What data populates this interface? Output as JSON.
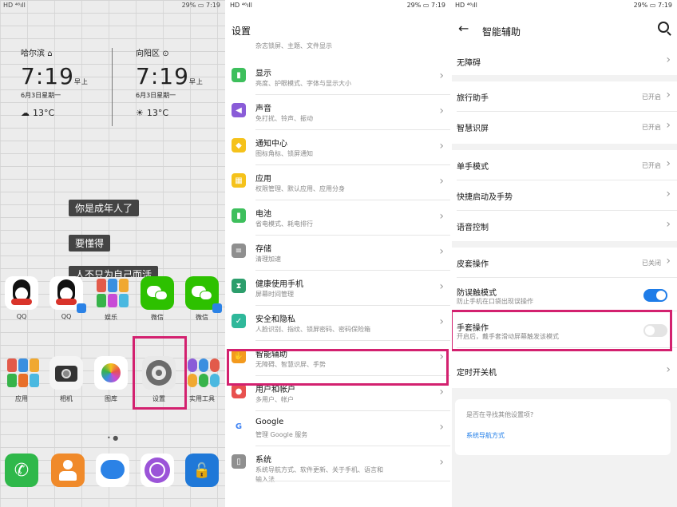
{
  "status": {
    "left": "HD ⁴⁶ıll",
    "battery": "29%",
    "time": "7:19"
  },
  "home": {
    "clock1": {
      "city": "哈尔滨",
      "time": "7:19",
      "ampm": "早上",
      "date": "6月3日星期一",
      "temp": "13°C"
    },
    "clock2": {
      "city": "向阳区",
      "time": "7:19",
      "ampm": "早上",
      "date": "6月3日星期一",
      "temp": "13°C"
    },
    "banners": [
      "你是成年人了",
      "要懂得",
      "人不只为自己而活"
    ],
    "row1": [
      {
        "label": "QQ"
      },
      {
        "label": "QQ"
      },
      {
        "label": "娱乐"
      },
      {
        "label": "微信"
      },
      {
        "label": "微信"
      }
    ],
    "row2": [
      {
        "label": "应用"
      },
      {
        "label": "相机"
      },
      {
        "label": "图库"
      },
      {
        "label": "设置"
      },
      {
        "label": "实用工具"
      }
    ]
  },
  "settings": {
    "title": "设置",
    "top_partial": "杂志锁屏、主题、文件显示",
    "items": [
      {
        "title": "显示",
        "sub": "亮度、护眼模式、字体与显示大小",
        "color": "#3dbf5c",
        "icon": "▮"
      },
      {
        "title": "声音",
        "sub": "免打扰、铃声、振动",
        "color": "#8a5cd8",
        "icon": "◀"
      },
      {
        "title": "通知中心",
        "sub": "图标角标、锁屏通知",
        "color": "#f5c21b",
        "icon": "◆"
      },
      {
        "title": "应用",
        "sub": "权限管理、默认应用、应用分身",
        "color": "#f5c21b",
        "icon": "▦"
      },
      {
        "title": "电池",
        "sub": "省电模式、耗电排行",
        "color": "#3dbf5c",
        "icon": "▮"
      },
      {
        "title": "存储",
        "sub": "清理加速",
        "color": "#8f8f8f",
        "icon": "≡"
      },
      {
        "title": "健康使用手机",
        "sub": "屏幕时间管理",
        "color": "#2c9e6c",
        "icon": "⧗"
      },
      {
        "title": "安全和隐私",
        "sub": "人脸识别、指纹、锁屏密码、密码保险箱",
        "color": "#2fb89a",
        "icon": "✓"
      },
      {
        "title": "智能辅助",
        "sub": "无障碍、智慧识屏、手势",
        "color": "#f39a1e",
        "icon": "✋"
      },
      {
        "title": "用户和帐户",
        "sub": "多用户、帐户",
        "color": "#e8514f",
        "icon": "●"
      },
      {
        "title": "Google",
        "sub": "管理 Google 服务",
        "color": "#ffffff",
        "icon": "G"
      },
      {
        "title": "系统",
        "sub": "系统导航方式、软件更新、关于手机、语言和",
        "sub2": "输入法",
        "color": "#8f8f8f",
        "icon": "▯"
      }
    ]
  },
  "assist": {
    "title": "智能辅助",
    "rows": {
      "accessibility": "无障碍",
      "travel": "旅行助手",
      "travel_val": "已开启",
      "smart_screen": "智慧识屏",
      "smart_screen_val": "已开启",
      "one_hand": "单手模式",
      "one_hand_val": "已开启",
      "quick_launch": "快捷启动及手势",
      "voice": "语音控制",
      "cover": "皮套操作",
      "cover_val": "已关闭",
      "mistouch": "防误触模式",
      "mistouch_sub": "防止手机在口袋出现误操作",
      "glove": "手套操作",
      "glove_sub": "开启后，戴手套滑动屏幕触发该模式",
      "timer": "定时开关机"
    },
    "help": {
      "question": "是否在寻找其他设置项?",
      "link": "系统导航方式"
    },
    "accent": "#1e7ce8",
    "highlight": "#d3216f"
  }
}
